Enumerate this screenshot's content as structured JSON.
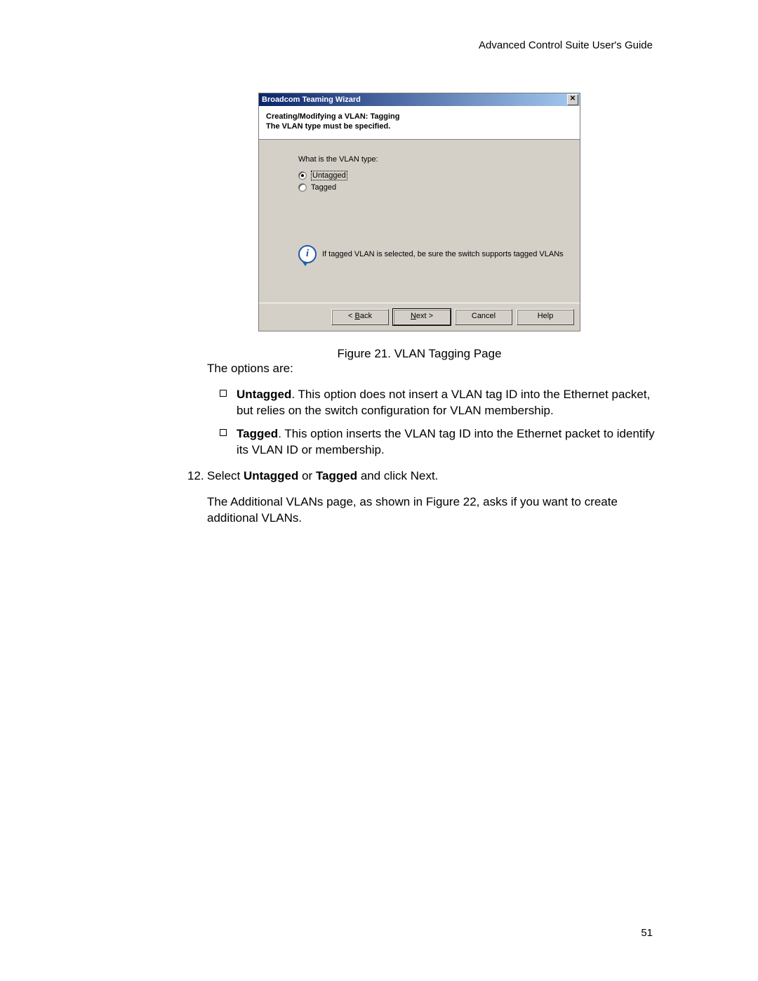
{
  "header": {
    "guide_title": "Advanced Control Suite User's Guide"
  },
  "dialog": {
    "title": "Broadcom Teaming Wizard",
    "close_glyph": "✕",
    "heading_line1": "Creating/Modifying a VLAN:  Tagging",
    "heading_line2": "The VLAN type must be specified.",
    "question": "What is the VLAN type:",
    "options": [
      {
        "label": "Untagged",
        "selected": true
      },
      {
        "label": "Tagged",
        "selected": false
      }
    ],
    "info_glyph": "i",
    "info_text": "If tagged VLAN is selected, be sure the switch supports tagged VLANs",
    "buttons": {
      "back_prefix": "< ",
      "back_u": "B",
      "back_rest": "ack",
      "next_u": "N",
      "next_rest": "ext >",
      "cancel": "Cancel",
      "help": "Help"
    }
  },
  "caption": "Figure 21. VLAN Tagging Page",
  "body": {
    "intro": "The options are:",
    "bullet1_bold": "Untagged",
    "bullet1_rest": ". This option does not insert a VLAN tag ID into the Ethernet packet, but relies on the switch configuration for VLAN membership.",
    "bullet2_bold": "Tagged",
    "bullet2_rest": ". This option inserts the VLAN tag ID into the Ethernet packet to identify its VLAN ID or membership.",
    "step_num": "12.",
    "step_pre": "Select ",
    "step_b1": "Untagged",
    "step_mid": " or ",
    "step_b2": "Tagged",
    "step_post": " and click Next.",
    "followup": "The Additional VLANs page, as shown in Figure 22, asks if you want to create additional VLANs."
  },
  "page_number": "51"
}
